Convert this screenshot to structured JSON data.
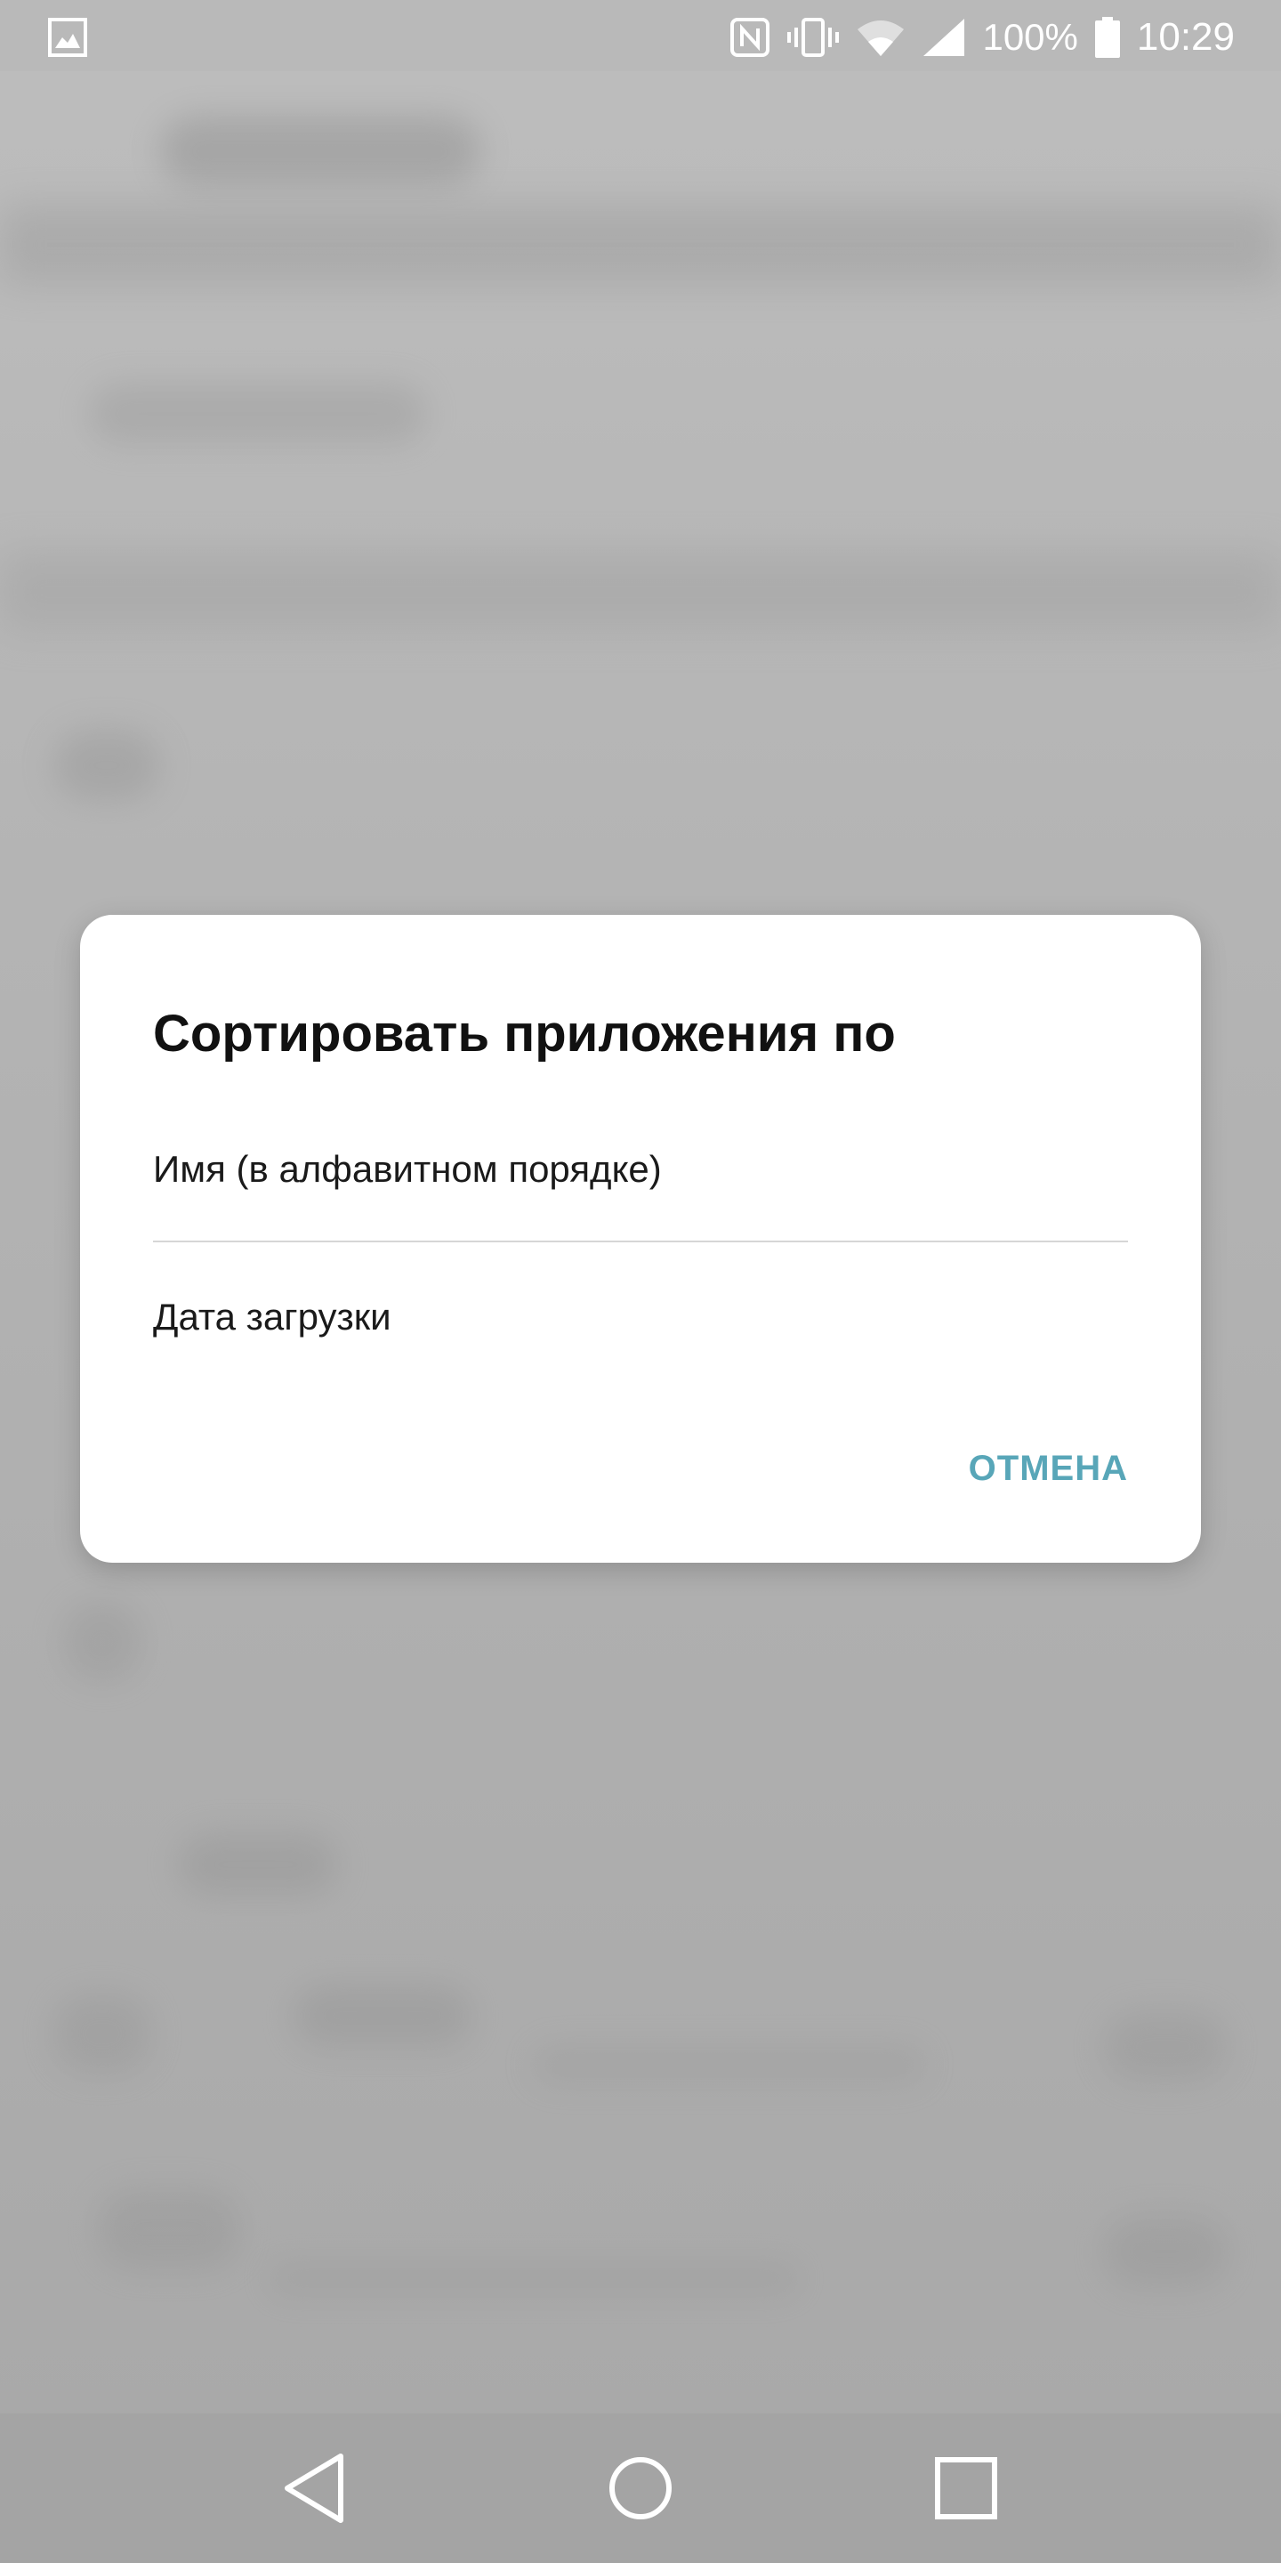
{
  "status_bar": {
    "battery_percent": "100%",
    "time": "10:29",
    "icons": [
      "image-notification-icon",
      "nfc-icon",
      "vibrate-icon",
      "wifi-icon",
      "signal-icon",
      "battery-icon"
    ]
  },
  "dialog": {
    "title": "Сортировать приложения по",
    "options": [
      {
        "label": "Имя (в алфавитном порядке)"
      },
      {
        "label": "Дата загрузки"
      }
    ],
    "cancel_label": "ОТМЕНА"
  },
  "nav_bar": {
    "icons": [
      "back-icon",
      "home-icon",
      "recents-icon"
    ]
  },
  "colors": {
    "accent": "#58a6b8",
    "dialog_bg": "#ffffff",
    "scrim_bg": "#a9a9a9"
  }
}
